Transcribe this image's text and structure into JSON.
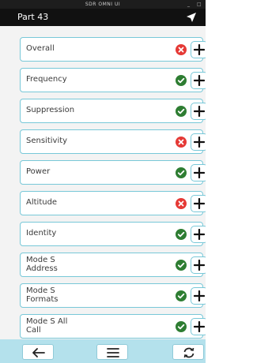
{
  "window": {
    "title": "SDR OMNI UI"
  },
  "header": {
    "title": "Part 43"
  },
  "tests": [
    {
      "label": "Overall",
      "status": "fail"
    },
    {
      "label": "Frequency",
      "status": "pass"
    },
    {
      "label": "Suppression",
      "status": "pass"
    },
    {
      "label": "Sensitivity",
      "status": "fail"
    },
    {
      "label": "Power",
      "status": "pass"
    },
    {
      "label": "Altitude",
      "status": "fail"
    },
    {
      "label": "Identity",
      "status": "pass"
    },
    {
      "label": "Mode S Address",
      "status": "pass"
    },
    {
      "label": "Mode S Formats",
      "status": "pass"
    },
    {
      "label": "Mode S All Call",
      "status": "pass"
    }
  ],
  "colors": {
    "pass": "#2e7d32",
    "fail": "#e53935",
    "accent": "#78c8d8",
    "bottom_bar": "#b4e1ec"
  },
  "bottom_bar": {
    "icons": [
      "back-arrow-icon",
      "menu-icon",
      "refresh-icon"
    ]
  }
}
